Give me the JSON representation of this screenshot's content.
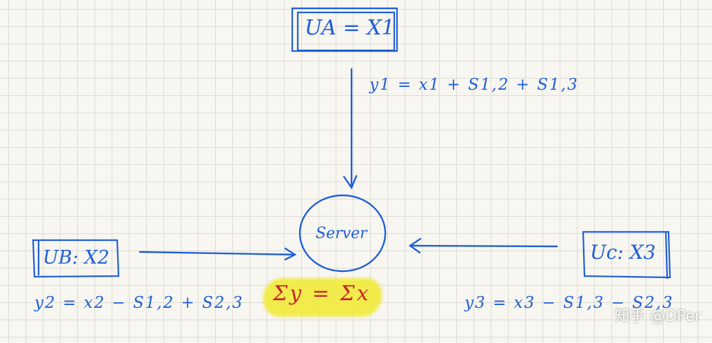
{
  "nodes": {
    "user_a": {
      "label": "UA = X1"
    },
    "user_b": {
      "label": "UB: X2"
    },
    "user_c": {
      "label": "Uc: X3"
    },
    "server": {
      "label": "Server"
    }
  },
  "equations": {
    "y1": "y1 = x1 + S1,2 + S1,3",
    "y2": "y2 = x2 − S1,2 + S2,3",
    "y3": "y3 = x3 − S1,3 − S2,3",
    "sum": "Σy = Σx"
  },
  "watermark": "知乎 @DPer",
  "colors": {
    "ink": "#1f5fd6",
    "sum_text": "#c8262e",
    "highlight": "#f1ea3a",
    "grid": "#dcdbd4"
  }
}
